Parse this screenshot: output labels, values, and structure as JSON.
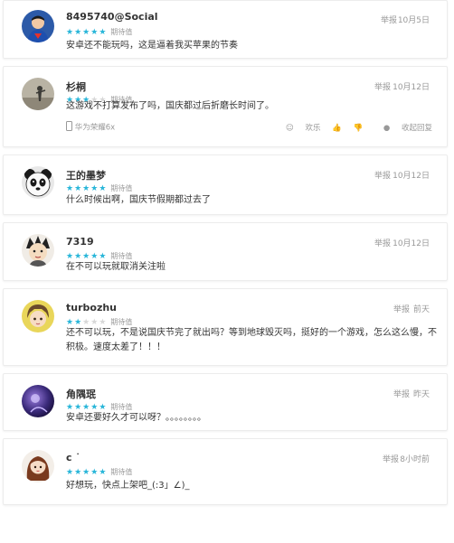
{
  "report_label": "举报",
  "rating_label": "期待值",
  "comments": [
    {
      "username": "8495740@Social",
      "stars": 5,
      "date": "10月5日",
      "content": "安卓还不能玩吗，这是逼着我买苹果的节奏",
      "avatar": "superman-avatar"
    },
    {
      "username": "杉桐",
      "stars": 3,
      "date": "10月12日",
      "content": "这游戏不打算发布了吗，国庆都过后折磨长时间了。",
      "device": "华为荣耀6x",
      "actions": {
        "like": "欢乐",
        "collapse": "收起回复"
      },
      "avatar": "silhouette-avatar"
    },
    {
      "username": "王的墨梦",
      "stars": 5,
      "date": "10月12日",
      "content": "什么时候出啊，国庆节假期都过去了",
      "avatar": "panda-avatar"
    },
    {
      "username": "7319",
      "stars": 5,
      "date": "10月12日",
      "content": "在不可以玩就取消关注啦",
      "avatar": "cartoon-boy-avatar"
    },
    {
      "username": "turbozhu",
      "stars": 2,
      "date": "前天",
      "content": "还不可以玩，不是说国庆节完了就出吗？等到地球毁灭吗，挺好的一个游戏，怎么这么慢，不积极。速度太差了！！！",
      "avatar": "anime-avatar"
    },
    {
      "username": "角隅珉",
      "stars": 5,
      "date": "昨天",
      "content": "安卓还要好久才可以呀？。。。。。。。。",
      "avatar": "purple-avatar"
    },
    {
      "username": "c ˙",
      "stars": 5,
      "date": "8小时前",
      "content": "好想玩，快点上架吧_(:3」∠)_",
      "avatar": "girl-avatar"
    }
  ]
}
